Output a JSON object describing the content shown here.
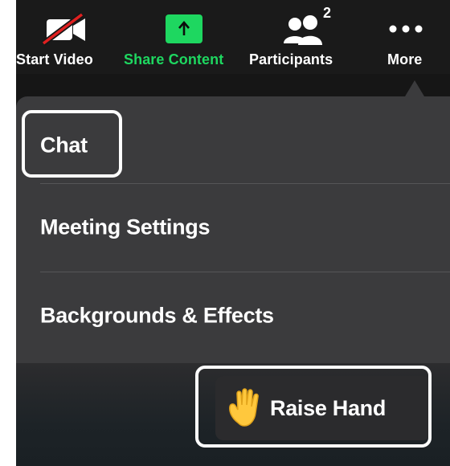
{
  "toolbar": {
    "start_video": {
      "label": "Start Video",
      "icon": "video-off-icon"
    },
    "share_content": {
      "label": "Share Content",
      "icon": "share-arrow-icon",
      "accent": "#1ed760"
    },
    "participants": {
      "label": "Participants",
      "icon": "people-icon",
      "count": "2"
    },
    "more": {
      "label": "More",
      "icon": "ellipsis-icon"
    }
  },
  "menu": {
    "items": [
      {
        "label": "Chat",
        "highlighted": true
      },
      {
        "label": "Meeting Settings",
        "highlighted": false
      },
      {
        "label": "Backgrounds & Effects",
        "highlighted": false
      }
    ]
  },
  "raise_hand": {
    "label": "Raise Hand",
    "icon": "raised-hand-icon",
    "highlighted": true
  },
  "colors": {
    "background": "#161616",
    "menu_bg": "#3b3b3d",
    "accent_green": "#1ed760",
    "mute_red": "#e02020",
    "hand_yellow": "#ffc83d"
  }
}
